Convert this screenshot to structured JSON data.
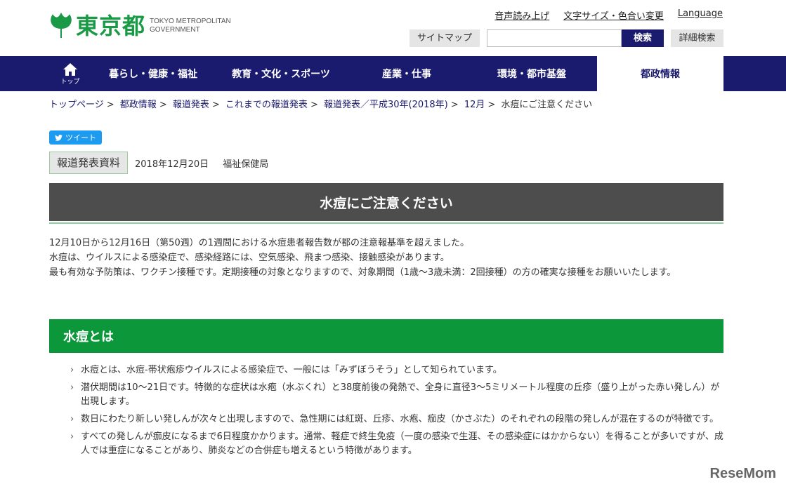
{
  "header": {
    "logo_text": "東京都",
    "logo_en_line1": "TOKYO METROPOLITAN",
    "logo_en_line2": "GOVERNMENT",
    "util_links": [
      "音声読み上げ",
      "文字サイズ・色合い変更",
      "Language"
    ],
    "sitemap_label": "サイトマップ",
    "search_placeholder": "",
    "search_label": "検索",
    "detail_search_label": "詳細検索"
  },
  "nav": {
    "home_label": "トップ",
    "items": [
      "暮らし・健康・福祉",
      "教育・文化・スポーツ",
      "産業・仕事",
      "環境・都市基盤",
      "都政情報"
    ]
  },
  "breadcrumb": {
    "items": [
      "トップページ",
      "都政情報",
      "報道発表",
      "これまでの報道発表",
      "報道発表／平成30年(2018年)",
      "12月"
    ],
    "current": "水痘にご注意ください",
    "separator": ">"
  },
  "tweet_label": "ツイート",
  "press": {
    "badge": "報道発表資料",
    "date": "2018年12月20日",
    "bureau": "福祉保健局"
  },
  "title": "水痘にご注意ください",
  "intro": [
    "12月10日から12月16日（第50週）の1週間における水痘患者報告数が都の注意報基準を超えました。",
    "水痘は、ウイルスによる感染症で、感染経路には、空気感染、飛まつ感染、接触感染があります。",
    "最も有効な予防策は、ワクチン接種です。定期接種の対象となりますので、対象期間（1歳～3歳未満：2回接種）の方の確実な接種をお願いいたします。"
  ],
  "section": {
    "heading": "水痘とは",
    "bullets": [
      "水痘とは、水痘-帯状疱疹ウイルスによる感染症で、一般には「みずぼうそう」として知られています。",
      "潜伏期間は10～21日です。特徴的な症状は水疱（水ぶくれ）と38度前後の発熱で、全身に直径3～5ミリメートル程度の丘疹（盛り上がった赤い発しん）が出現します。",
      "数日にわたり新しい発しんが次々と出現しますので、急性期には紅斑、丘疹、水疱、痂皮（かさぶた）のそれぞれの段階の発しんが混在するのが特徴です。",
      "すべての発しんが痂皮になるまで6日程度かかります。通常、軽症で終生免疫（一度の感染で生涯、その感染症にはかからない）を得ることが多いですが、成人では重症になることがあり、肺炎などの合併症も増えるという特徴があります。"
    ]
  },
  "watermark": "ReseMom",
  "colors": {
    "navy": "#1a1a6e",
    "green": "#0b973a",
    "title_gray": "#4d4d4d",
    "logo_green": "#1a9a46",
    "twitter": "#1d9bf0"
  }
}
